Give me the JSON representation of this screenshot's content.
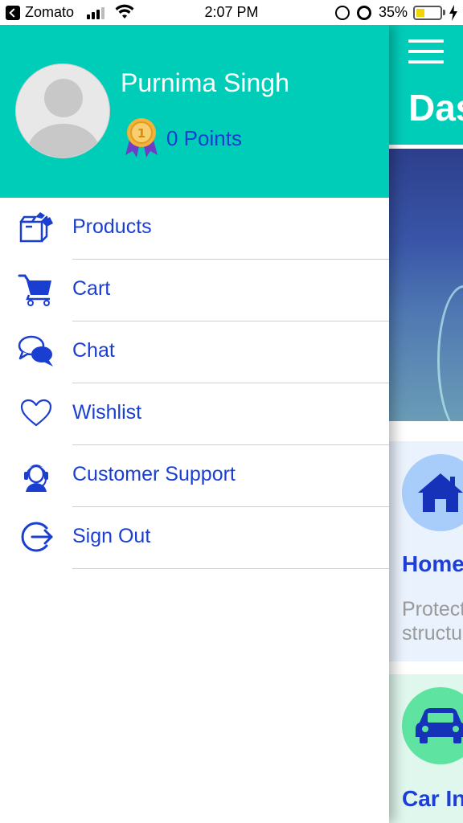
{
  "status_bar": {
    "back_app": "Zomato",
    "time": "2:07 PM",
    "battery_percent": "35%",
    "battery_level": 0.35
  },
  "background_screen": {
    "title": "Dashboard",
    "header_color": "#00cdb8",
    "cards": [
      {
        "title": "Home Insurance",
        "description_line1": "Protect your",
        "description_line2": "structure",
        "icon": "house-icon",
        "circle_color": "#a9cdfa"
      },
      {
        "title": "Car Insurance",
        "icon": "car-icon",
        "circle_color": "#5fe3a0"
      }
    ]
  },
  "drawer": {
    "header_color": "#00cdb8",
    "user_name": "Purnima Singh",
    "points_label": "0 Points",
    "menu_items": [
      {
        "label": "Products",
        "icon": "box-icon"
      },
      {
        "label": "Cart",
        "icon": "cart-icon"
      },
      {
        "label": "Chat",
        "icon": "chat-icon"
      },
      {
        "label": "Wishlist",
        "icon": "heart-icon"
      },
      {
        "label": "Customer Support",
        "icon": "headset-icon"
      },
      {
        "label": "Sign Out",
        "icon": "sign-out-icon"
      }
    ],
    "accent_color": "#1a3fd0"
  }
}
